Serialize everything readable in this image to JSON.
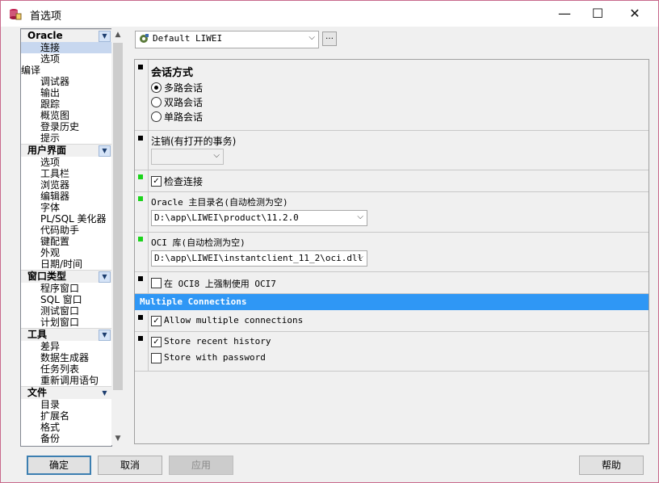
{
  "window": {
    "title": "首选项"
  },
  "window_controls": {
    "minimize": "—",
    "maximize": "☐",
    "close": "✕"
  },
  "sidebar": {
    "groups": [
      {
        "header": "Oracle",
        "items": [
          "连接",
          "选项"
        ]
      },
      {
        "header": "编译",
        "flat": true,
        "items": [
          "调试器",
          "输出",
          "跟踪",
          "概览图",
          "登录历史",
          "提示"
        ]
      },
      {
        "header": "用户界面",
        "items": [
          "选项",
          "工具栏",
          "浏览器",
          "编辑器",
          "字体",
          "PL/SQL 美化器",
          "代码助手",
          "键配置",
          "外观",
          "日期/时间"
        ]
      },
      {
        "header": "窗口类型",
        "items": [
          "程序窗口",
          "SQL 窗口",
          "测试窗口",
          "计划窗口"
        ]
      },
      {
        "header": "工具",
        "items": [
          "差异",
          "数据生成器",
          "任务列表",
          "重新调用语句"
        ]
      },
      {
        "header": "文件",
        "items": [
          "目录",
          "扩展名",
          "格式",
          "备份"
        ]
      }
    ],
    "selected": "连接"
  },
  "profile": {
    "value": "Default LIWEI",
    "more": "…"
  },
  "connection": {
    "session_mode_title": "会话方式",
    "session_modes": [
      "多路会话",
      "双路会话",
      "单路会话"
    ],
    "session_mode_selected": 0,
    "logoff_label": "注销(有打开的事务)",
    "logoff_value": "",
    "check_connection_label": "检查连接",
    "check_connection_checked": true,
    "oracle_home_label": "Oracle 主目录名(自动检测为空)",
    "oracle_home_value": "D:\\app\\LIWEI\\product\\11.2.0",
    "oci_label": "OCI 库(自动检测为空)",
    "oci_value": "D:\\app\\LIWEI\\instantclient_11_2\\oci.dll",
    "force_oci7_label": "在 OCI8 上强制使用 OCI7",
    "force_oci7_checked": false,
    "multiple_connections_header": "Multiple Connections",
    "allow_multiple_label": "Allow multiple connections",
    "allow_multiple_checked": true,
    "store_history_label": "Store recent history",
    "store_history_checked": true,
    "store_password_label": "Store with password",
    "store_password_checked": false
  },
  "buttons": {
    "ok": "确定",
    "cancel": "取消",
    "apply": "应用",
    "help": "帮助"
  },
  "colors": {
    "accent": "#2f97f5",
    "selection": "#c7d7ef",
    "marker_changed": "#1bd41b"
  }
}
